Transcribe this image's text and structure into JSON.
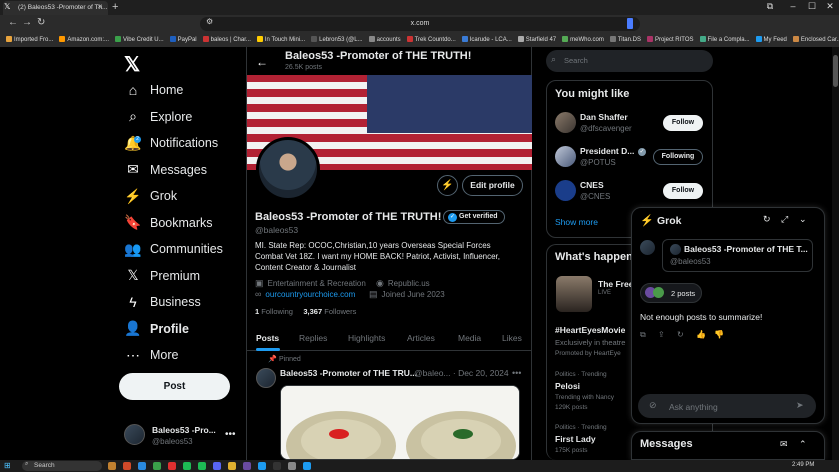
{
  "browser": {
    "tab_title": "(2) Baleos53 -Promoter of Th...",
    "url": "x.com",
    "bookmarks": [
      "Imported Fro...",
      "Amazon.com:...",
      "Vibe Credit U...",
      "PayPal",
      "baleos | Char...",
      "In Touch Mini...",
      "Lebron53 (@L...",
      "accounts",
      "Trek Countdo...",
      "Icarude - LCA...",
      "Starfield 47",
      "meWho.com",
      "Titan.DS",
      "Project RITOS",
      "File a Compla...",
      "My Feed",
      "Enclosed Car..."
    ]
  },
  "nav": {
    "items": [
      {
        "label": "Home",
        "icon": "home-icon"
      },
      {
        "label": "Explore",
        "icon": "search-icon"
      },
      {
        "label": "Notifications",
        "icon": "bell-icon"
      },
      {
        "label": "Messages",
        "icon": "mail-icon"
      },
      {
        "label": "Grok",
        "icon": "grok-icon"
      },
      {
        "label": "Bookmarks",
        "icon": "bookmark-icon"
      },
      {
        "label": "Communities",
        "icon": "people-icon"
      },
      {
        "label": "Premium",
        "icon": "x-logo-icon"
      },
      {
        "label": "Business",
        "icon": "lightning-icon"
      },
      {
        "label": "Profile",
        "icon": "person-icon"
      },
      {
        "label": "More",
        "icon": "more-circle-icon"
      }
    ],
    "notification_badge": "2",
    "post_label": "Post",
    "account_name": "Baleos53 -Pro...",
    "account_handle": "@baleos53"
  },
  "header": {
    "title": "Baleos53 -Promoter of THE TRUTH!",
    "post_count": "26.5K posts"
  },
  "profile": {
    "name": "Baleos53 -Promoter of THE TRUTH!",
    "get_verified": "Get verified",
    "handle": "@baleos53",
    "bio": "MI. State Rep: OCOC,Christian,10 years Overseas Special Forces Combat Vet 18Z. I want my HOME BACK! Patriot, Activist, Influencer, Content Creator & Journalist",
    "category": "Entertainment & Recreation",
    "location": "Republic.us",
    "link": "ourcountryourchoice.com",
    "joined": "Joined June 2023",
    "following_count": "1",
    "following_label": "Following",
    "followers_count": "3,367",
    "followers_label": "Followers",
    "edit_profile": "Edit profile",
    "tabs": [
      "Posts",
      "Replies",
      "Highlights",
      "Articles",
      "Media",
      "Likes"
    ]
  },
  "pinned_post": {
    "pinned_label": "Pinned",
    "author": "Baleos53 -Promoter of THE TRU...",
    "meta": "@baleo... · Dec 20, 2024"
  },
  "search": {
    "placeholder": "Search"
  },
  "who_to_follow": {
    "title": "You might like",
    "people": [
      {
        "name": "Dan Shaffer",
        "handle": "@dfscavenger",
        "button": "Follow"
      },
      {
        "name": "President D...",
        "handle": "@POTUS",
        "button": "Following"
      },
      {
        "name": "CNES",
        "handle": "@CNES",
        "button": "Follow"
      }
    ],
    "show_more": "Show more"
  },
  "happening": {
    "title": "What's happening",
    "event_name": "The Free",
    "event_status": "LIVE",
    "promoted": {
      "name": "#HeartEyesMovie",
      "sub": "Exclusively in theatre",
      "promo": "Promoted by HeartEye"
    },
    "trends": [
      {
        "category": "Politics · Trending",
        "name": "Pelosi",
        "sub": "Trending with Nancy",
        "count": "129K posts"
      },
      {
        "category": "Politics · Trending",
        "name": "First Lady",
        "sub": "",
        "count": "175K posts"
      }
    ]
  },
  "grok": {
    "title": "Grok",
    "card_name": "Baleos53 -Promoter of THE T...",
    "card_handle": "@baleos53",
    "posts_chip": "2 posts",
    "reply": "Not enough posts to summarize!",
    "input_placeholder": "Ask anything"
  },
  "messages": {
    "title": "Messages"
  },
  "taskbar": {
    "search_label": "Search",
    "time": "2:49 PM"
  },
  "colors": {
    "accent": "#1d9bf0",
    "background": "#000000",
    "border": "#2f3336",
    "muted": "#71767b"
  }
}
